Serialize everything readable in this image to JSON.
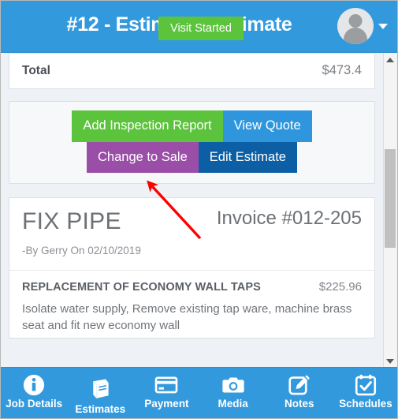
{
  "header": {
    "title": "#12 - Estimates Estimate",
    "badge_label": "Visit Started",
    "badge_color": "#5cc33c",
    "bar_color": "#3399dd",
    "avatar_icon": "user-avatar-icon",
    "caret_icon": "chevron-down-icon"
  },
  "summary": {
    "total_label": "Total",
    "total_value": "$473.4"
  },
  "actions": {
    "add_inspection_report": "Add Inspection Report",
    "view_quote": "View Quote",
    "change_to_sale": "Change to Sale",
    "edit_estimate": "Edit Estimate",
    "colors": {
      "add_inspection_report": "#5cc33c",
      "view_quote": "#2f96dd",
      "change_to_sale": "#9b4ea8",
      "edit_estimate": "#0c5fa5"
    }
  },
  "invoice": {
    "title": "FIX PIPE",
    "number": "Invoice #012-205",
    "byline": "-By Gerry On 02/10/2019",
    "line_items": [
      {
        "name": "REPLACEMENT OF ECONOMY WALL TAPS",
        "price": "$225.96",
        "description": "Isolate water supply, Remove existing tap ware, machine brass seat and fit new economy wall"
      }
    ]
  },
  "scrollbar": {
    "up_icon": "triangle-up-icon",
    "down_icon": "triangle-down-icon"
  },
  "annotation": {
    "arrow_color": "#ff0000",
    "points_to": "Change to Sale"
  },
  "bottom_nav": [
    {
      "label": "Job Details",
      "icon": "info-circle-icon",
      "lower": false
    },
    {
      "label": "Estimates",
      "icon": "book-icon",
      "lower": true
    },
    {
      "label": "Payment",
      "icon": "credit-card-icon",
      "lower": false
    },
    {
      "label": "Media",
      "icon": "camera-icon",
      "lower": false
    },
    {
      "label": "Notes",
      "icon": "edit-pencil-icon",
      "lower": false
    },
    {
      "label": "Schedules",
      "icon": "calendar-check-icon",
      "lower": false
    }
  ]
}
